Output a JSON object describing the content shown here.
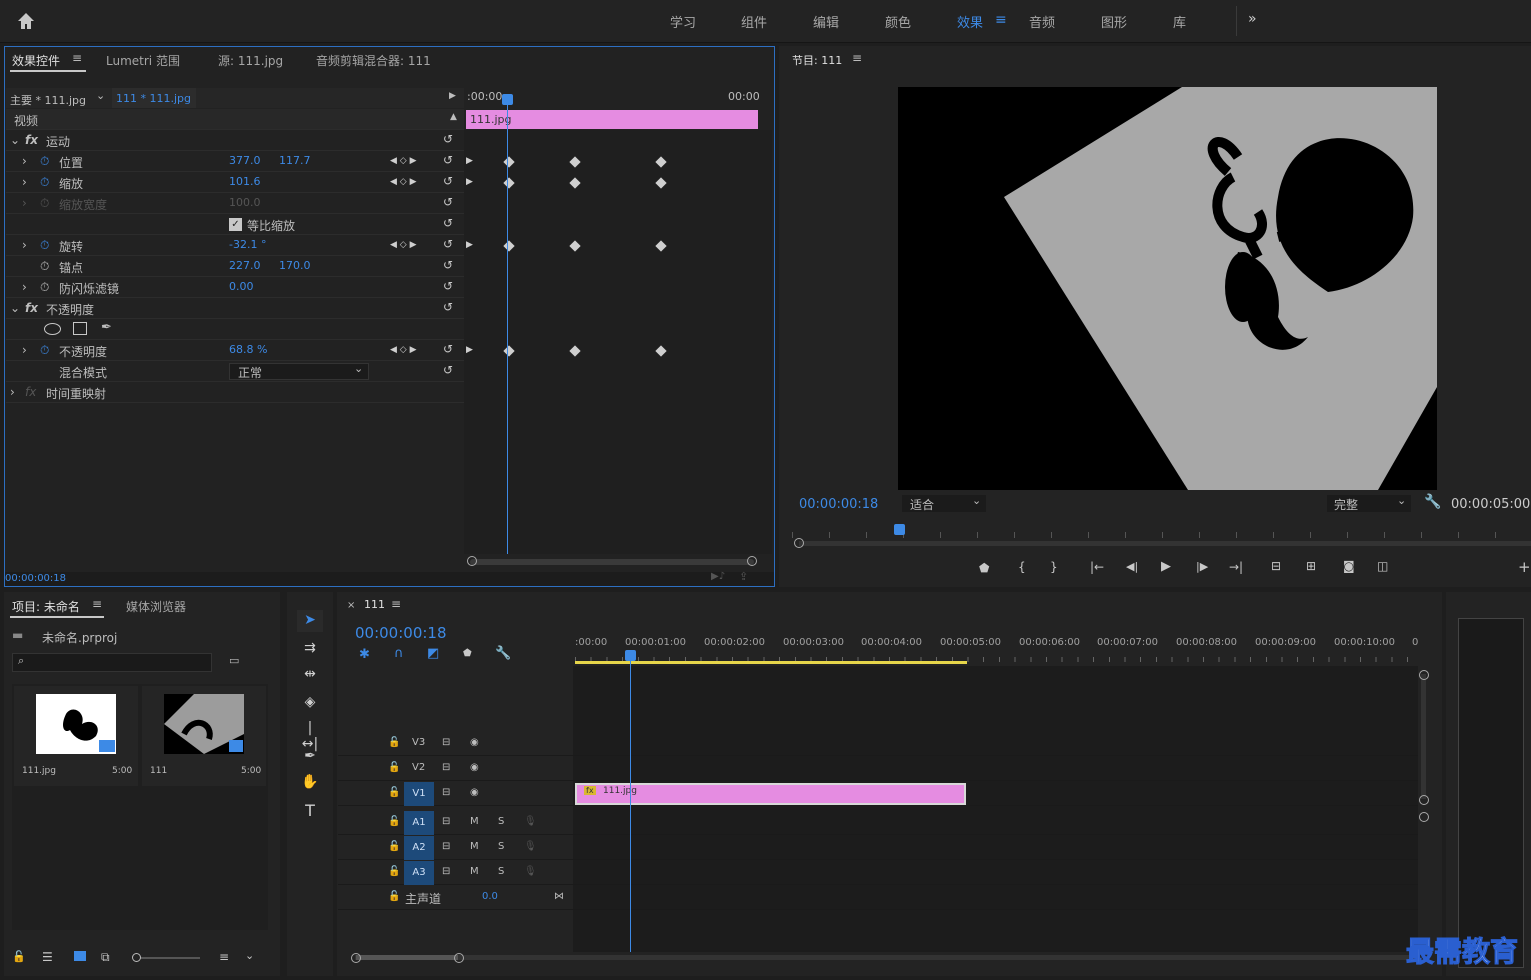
{
  "workspaces": [
    "学习",
    "组件",
    "编辑",
    "颜色",
    "效果",
    "音频",
    "图形",
    "库"
  ],
  "active_workspace": "效果",
  "effect_panel": {
    "tabs": [
      "效果控件",
      "Lumetri 范围",
      "源: 111.jpg",
      "音频剪辑混合器: 111"
    ],
    "master_clip": "主要 * 111.jpg",
    "sequence_clip": "111 * 111.jpg",
    "tl_start": ":00:00",
    "tl_end": "00:00",
    "clip_label": "111.jpg",
    "video_label": "视频",
    "props": {
      "motion": "运动",
      "position": "位置",
      "pos_x": "377.0",
      "pos_y": "117.7",
      "scale": "缩放",
      "scale_v": "101.6",
      "scale_w": "缩放宽度",
      "scale_w_v": "100.0",
      "uniform": "等比缩放",
      "rotation": "旋转",
      "rotation_v": "-32.1 °",
      "anchor": "锚点",
      "anchor_x": "227.0",
      "anchor_y": "170.0",
      "flicker": "防闪烁滤镜",
      "flicker_v": "0.00",
      "opacity_group": "不透明度",
      "opacity": "不透明度",
      "opacity_v": "68.8 %",
      "blend": "混合模式",
      "blend_v": "正常",
      "remap": "时间重映射"
    },
    "timecode": "00:00:00:18"
  },
  "program": {
    "title": "节目: 111",
    "timecode": "00:00:00:18",
    "fit": "适合",
    "quality": "完整",
    "duration": "00:00:05:00"
  },
  "project": {
    "tabs": [
      "项目: 未命名",
      "媒体浏览器"
    ],
    "file": "未命名.prproj",
    "items": [
      {
        "name": "111.jpg",
        "dur": "5:00"
      },
      {
        "name": "111",
        "dur": "5:00"
      }
    ]
  },
  "timeline": {
    "title": "111",
    "timecode": "00:00:00:18",
    "ruler": [
      ":00:00",
      "00:00:01:00",
      "00:00:02:00",
      "00:00:03:00",
      "00:00:04:00",
      "00:00:05:00",
      "00:00:06:00",
      "00:00:07:00",
      "00:00:08:00",
      "00:00:09:00",
      "00:00:10:00",
      "0"
    ],
    "tracks": {
      "v3": "V3",
      "v2": "V2",
      "v1": "V1",
      "a1": "A1",
      "a2": "A2",
      "a3": "A3"
    },
    "mute": "M",
    "solo": "S",
    "master": "主声道",
    "master_v": "0.0",
    "clip_label": "111.jpg"
  },
  "watermark": "最需教育"
}
